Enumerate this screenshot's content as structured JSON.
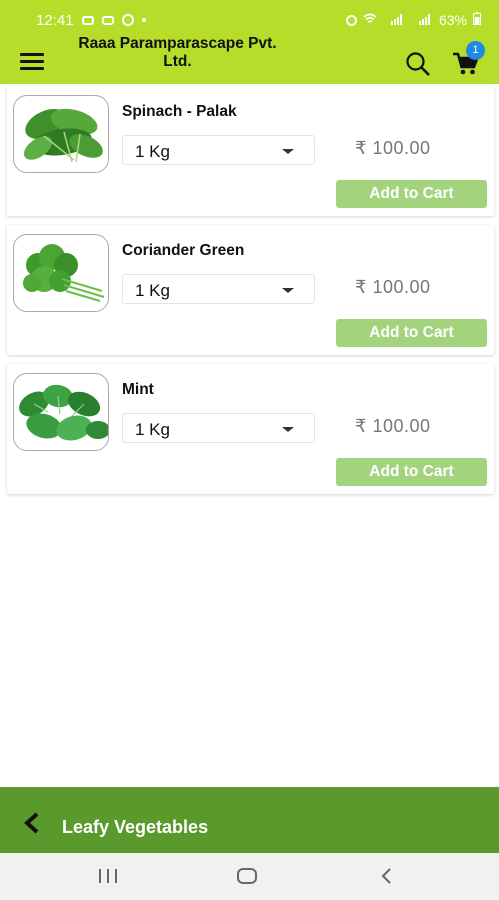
{
  "status_bar": {
    "time": "12:41",
    "battery": "63%"
  },
  "app_bar": {
    "title": "Raaa Paramparascape Pvt. Ltd.",
    "cart_count": "1"
  },
  "products": [
    {
      "name": "Spinach - Palak",
      "quantity": "1 Kg",
      "price": "₹ 100.00",
      "button": "Add to Cart"
    },
    {
      "name": "Coriander Green",
      "quantity": "1 Kg",
      "price": "₹ 100.00",
      "button": "Add to Cart"
    },
    {
      "name": "Mint",
      "quantity": "1 Kg",
      "price": "₹ 100.00",
      "button": "Add to Cart"
    }
  ],
  "bottom_bar": {
    "category": "Leafy Vegetables"
  },
  "colors": {
    "brand_lime": "#b5dd29",
    "category_green": "#5a9a2d",
    "button_green": "#a3d47d",
    "badge_blue": "#1f8be0"
  },
  "icons": [
    "hamburger-menu-icon",
    "search-icon",
    "cart-icon",
    "back-arrow-icon",
    "recent-apps-icon",
    "home-icon",
    "nav-back-icon"
  ]
}
